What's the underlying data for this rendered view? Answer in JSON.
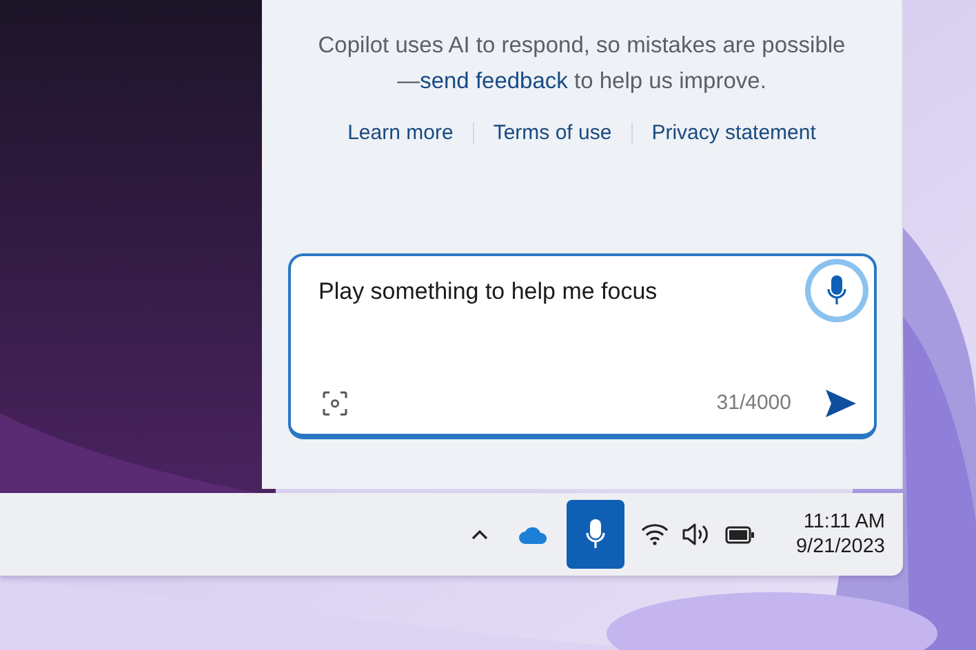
{
  "copilot_panel": {
    "disclaimer": {
      "before": "Copilot uses AI to respond, so mistakes are possible—",
      "link": "send feedback",
      "after": " to help us improve."
    },
    "links": [
      "Learn more",
      "Terms of use",
      "Privacy statement"
    ],
    "composer": {
      "value": "Play something to help me focus",
      "counter": "31/4000",
      "mic_listening": true
    }
  },
  "taskbar": {
    "mic_active": true,
    "time": "11:11 AM",
    "date": "9/21/2023"
  }
}
